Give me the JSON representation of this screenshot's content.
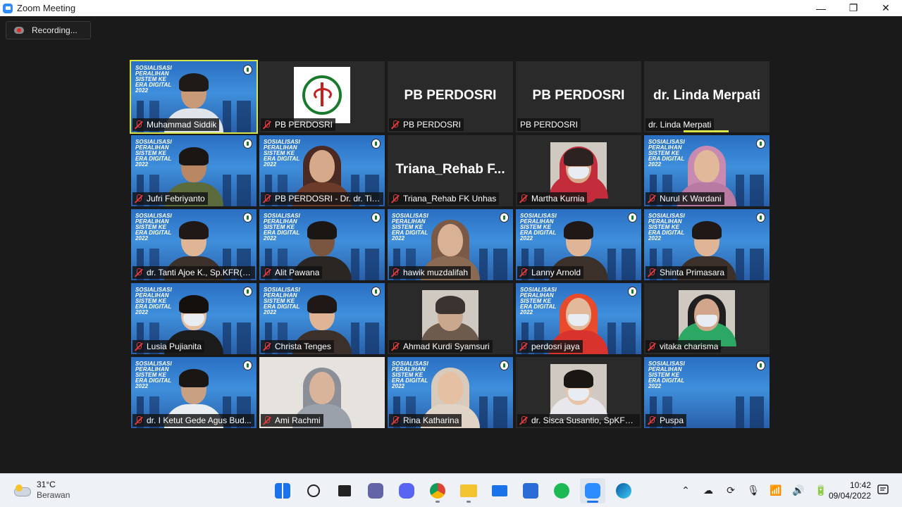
{
  "window": {
    "title": "Zoom Meeting",
    "controls": [
      "—",
      "❐",
      "✕"
    ]
  },
  "recording": {
    "label": "Recording..."
  },
  "slide": {
    "lines": [
      "SOSIALISASI",
      "PERALIHAN",
      "SISTEM KE",
      "ERA DIGITAL",
      "2022"
    ]
  },
  "participants": [
    {
      "name": "Muhammad Siddik",
      "type": "slide",
      "person": "man",
      "active": true,
      "muted": false,
      "speaking_icon": true
    },
    {
      "name": "PB PERDOSRI",
      "type": "logo",
      "muted": true
    },
    {
      "name": "PB PERDOSRI",
      "type": "text",
      "big": "PB PERDOSRI",
      "muted": true
    },
    {
      "name": "PB PERDOSRI",
      "type": "text",
      "big": "PB PERDOSRI",
      "muted": false
    },
    {
      "name": "dr. Linda Merpati",
      "type": "text",
      "big": "dr. Linda Merpati",
      "muted": false,
      "speaking": true
    },
    {
      "name": "Jufri Febriyanto",
      "type": "slide",
      "person": "man-batik",
      "muted": true
    },
    {
      "name": "PB PERDOSRI - Dr. dr. Tir...",
      "type": "slide",
      "person": "woman-hijab-dark",
      "muted": true
    },
    {
      "name": "Triana_Rehab FK Unhas",
      "type": "text",
      "big": "Triana_Rehab  F...",
      "muted": true
    },
    {
      "name": "Martha Kurnia",
      "type": "photo",
      "person": "woman-red",
      "muted": true
    },
    {
      "name": "Nurul K Wardani",
      "type": "slide",
      "person": "woman-hijab-pink",
      "muted": true
    },
    {
      "name": "dr. Tanti Ajoe K., Sp.KFR(K...",
      "type": "slide",
      "person": "woman",
      "muted": true
    },
    {
      "name": "Alit Pawana",
      "type": "slide",
      "person": "man-dark",
      "muted": true
    },
    {
      "name": "hawik muzdalifah",
      "type": "slide",
      "person": "woman-hijab-brown",
      "muted": true
    },
    {
      "name": "Lanny Arnold",
      "type": "slide",
      "person": "woman",
      "muted": true
    },
    {
      "name": "Shinta Primasara",
      "type": "slide",
      "person": "woman",
      "muted": true
    },
    {
      "name": "Lusia Pujianita",
      "type": "slide",
      "person": "woman-mask",
      "muted": true
    },
    {
      "name": "Christa Tenges",
      "type": "slide",
      "person": "woman",
      "muted": true
    },
    {
      "name": "Ahmad Kurdi Syamsuri",
      "type": "photo",
      "person": "man-light",
      "muted": true
    },
    {
      "name": "perdosri jaya",
      "type": "slide",
      "person": "woman-red-hijab",
      "muted": true
    },
    {
      "name": "vitaka charisma",
      "type": "photo",
      "person": "woman-green-hijab",
      "muted": true
    },
    {
      "name": "dr. I Ketut Gede Agus Bud...",
      "type": "slide",
      "person": "man-glasses",
      "muted": true
    },
    {
      "name": "Ami Rachmi",
      "type": "plain",
      "person": "woman-hijab-grey",
      "muted": true
    },
    {
      "name": "Rina Katharina",
      "type": "slide",
      "person": "woman-hijab-light",
      "muted": true
    },
    {
      "name": "dr. Sisca Susantio, SpKFR(...",
      "type": "photo",
      "person": "woman-mask-plain",
      "muted": true
    },
    {
      "name": "Puspa",
      "type": "slide",
      "person": "none",
      "muted": true
    }
  ],
  "taskbar": {
    "weather": {
      "temp": "31°C",
      "condition": "Berawan"
    },
    "apps": [
      "windows-start",
      "search",
      "task-view",
      "teams-chat",
      "discord",
      "chrome",
      "file-explorer",
      "mail",
      "microsoft-store",
      "spotify",
      "zoom",
      "edge"
    ],
    "time": "10:42",
    "date": "09/04/2022"
  },
  "colors": {
    "meeting_bg": "#1a1a1a",
    "tile_bg": "#2a2a2a",
    "active_outline": "#d9e64a",
    "mute_red": "#e23b3b",
    "taskbar_bg": "#eef2f7"
  }
}
